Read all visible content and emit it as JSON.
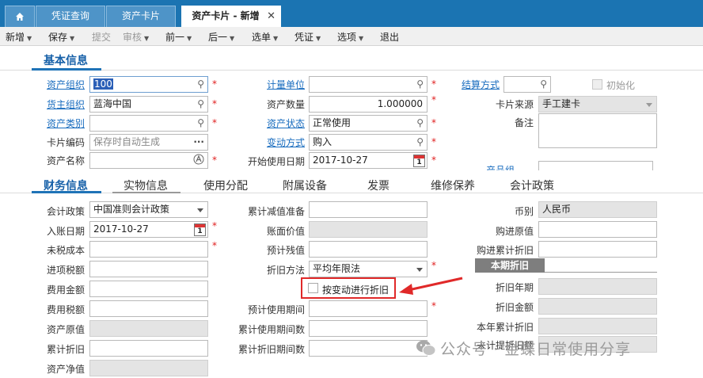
{
  "tabs": {
    "home_icon": "home-icon",
    "voucher_query": "凭证查询",
    "asset_card": "资产卡片",
    "active": "资产卡片 - 新增",
    "close": "✕"
  },
  "toolbar": {
    "new": "新增",
    "save": "保存",
    "submit": "提交",
    "audit": "审核",
    "prev": "前一",
    "next": "后一",
    "select": "选单",
    "voucher": "凭证",
    "options": "选项",
    "exit": "退出"
  },
  "basic": {
    "title": "基本信息",
    "org_label": "资产组织",
    "org_value": "100",
    "owner_label": "货主组织",
    "owner_value": "蓝海中国",
    "category_label": "资产类别",
    "category_value": "",
    "card_code_label": "卡片编码",
    "card_code_placeholder": "保存时自动生成",
    "asset_name_label": "资产名称",
    "asset_name_value": "",
    "unit_label": "计量单位",
    "unit_value": "",
    "qty_label": "资产数量",
    "qty_value": "1.000000",
    "status_label": "资产状态",
    "status_value": "正常使用",
    "change_label": "变动方式",
    "change_value": "购入",
    "start_date_label": "开始使用日期",
    "start_date_value": "2017-10-27",
    "settle_label": "结算方式",
    "settle_value": "",
    "init_label": "初始化",
    "source_label": "卡片来源",
    "source_value": "手工建卡",
    "remark_label": "备注",
    "remark_value": "",
    "product_group_label": "产品组"
  },
  "fin_tabs": [
    "财务信息",
    "实物信息",
    "使用分配",
    "附属设备",
    "发票",
    "维修保养",
    "会计政策"
  ],
  "fin": {
    "policy_label": "会计政策",
    "policy_value": "中国准则会计政策",
    "entry_date_label": "入账日期",
    "entry_date_value": "2017-10-27",
    "untaxed_cost_label": "未税成本",
    "untaxed_cost_value": "",
    "input_tax_label": "进项税额",
    "input_tax_value": "",
    "expense_label": "费用金额",
    "expense_value": "",
    "expense_tax_label": "费用税额",
    "expense_tax_value": "",
    "orig_value_label": "资产原值",
    "orig_value_value": "",
    "acc_dep_label": "累计折旧",
    "acc_dep_value": "",
    "net_value_label": "资产净值",
    "net_value_value": "",
    "impair_label": "累计减值准备",
    "impair_value": "",
    "book_value_label": "账面价值",
    "book_value_value": "",
    "residual_label": "预计残值",
    "residual_value": "",
    "method_label": "折旧方法",
    "method_value": "平均年限法",
    "by_change_label": "按变动进行折旧",
    "life_label": "预计使用期间",
    "life_value": "",
    "used_label": "累计使用期间数",
    "used_value": "",
    "dep_periods_label": "累计折旧期间数",
    "dep_periods_value": "",
    "currency_label": "币别",
    "currency_value": "人民币",
    "purchase_orig_label": "购进原值",
    "purchase_orig_value": "",
    "purchase_dep_label": "购进累计折旧",
    "purchase_dep_value": "",
    "current_dep_band": "本期折旧",
    "dep_year_label": "折旧年期",
    "dep_year_value": "",
    "dep_amount_label": "折旧金额",
    "dep_amount_value": "",
    "year_dep_label": "本年累计折旧",
    "year_dep_value": "",
    "unaccrued_label": "未计提折旧额",
    "unaccrued_value": ""
  },
  "watermark": "公众号 · 金蝶日常使用分享",
  "colors": {
    "tabbar": "#1b74b2",
    "accent": "#1f73b7",
    "link": "#1a6dbf",
    "required": "#e02020",
    "highlight": "#e02929"
  }
}
